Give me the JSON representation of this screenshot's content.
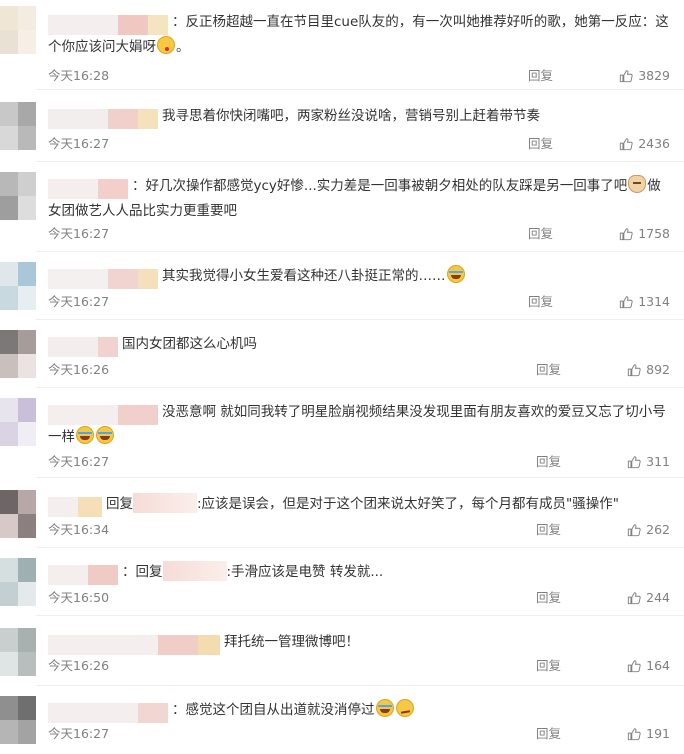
{
  "comments": [
    {
      "avatar_colors": [
        "#efe6d6",
        "#f3ece1",
        "#e9e1d3",
        "#f5efe6"
      ],
      "name_colors": [
        "#f4eeee",
        "#f0c8c1",
        "#f5e4c0"
      ],
      "prefix": "：",
      "reply_to": false,
      "text": "反正杨超越一直在节目里cue队友的，有一次叫她推荐好听的歌，她第一反应：这个你应该问大娟呀",
      "emojis": [
        "kiss"
      ],
      "suffix": "。",
      "time": "今天16:28",
      "reply_label": "回复",
      "likes": "3829"
    },
    {
      "avatar_colors": [
        "#c8c8c8",
        "#a8a8a8",
        "#d8d8d8",
        "#b9b9b9"
      ],
      "name_colors": [
        "#f3eeee",
        "#f1d0cc",
        "#f5e2bd"
      ],
      "prefix": "",
      "reply_to": false,
      "text": "我寻思着你快闭嘴吧，两家粉丝没说啥，营销号别上赶着带节奏",
      "emojis": [],
      "suffix": "",
      "time": "今天16:27",
      "reply_label": "回复",
      "likes": "2436"
    },
    {
      "avatar_colors": [
        "#b8b8b8",
        "#cfcfcf",
        "#9e9e9e",
        "#dddddd"
      ],
      "name_colors": [
        "#f6eeee",
        "#f2cfca"
      ],
      "prefix": "：",
      "reply_to": false,
      "text": "好几次操作都感觉ycy好惨...实力差是一回事被朝夕相处的队友踩是另一回事了吧",
      "emojis": [
        "cat"
      ],
      "suffix": "做女团做艺人人品比实力更重要吧",
      "time": "今天16:27",
      "reply_label": "回复",
      "likes": "1758"
    },
    {
      "avatar_colors": [
        "#dfe7ea",
        "#a9c7d8",
        "#c9d9e0",
        "#e6eef1"
      ],
      "name_colors": [
        "#f4f0f0",
        "#f1d3cf",
        "#f5e0bd"
      ],
      "prefix": "",
      "reply_to": false,
      "text": "其实我觉得小女生爱看这种还八卦挺正常的……",
      "emojis": [
        "laugh"
      ],
      "suffix": "",
      "time": "今天16:27",
      "reply_label": "回复",
      "likes": "1314"
    },
    {
      "avatar_colors": [
        "#7d7878",
        "#a69d9b",
        "#c9bfbd",
        "#eae3e1"
      ],
      "name_colors": [
        "#f3eded",
        "#f0d2ce"
      ],
      "prefix": "",
      "reply_to": false,
      "text": "国内女团都这么心机吗",
      "emojis": [],
      "suffix": "",
      "time": "今天16:26",
      "reply_label": "回复",
      "likes": "892"
    },
    {
      "avatar_colors": [
        "#e8e4ee",
        "#c9bfd8",
        "#d9d3e3",
        "#f0edf4"
      ],
      "name_colors": [
        "#f5eeee",
        "#f1cfca"
      ],
      "prefix": "",
      "reply_to": false,
      "text": "没恶意啊 就如同我转了明星脸崩视频结果没发现里面有朋友喜欢的爱豆又忘了切小号一样",
      "emojis": [
        "laugh",
        "laugh"
      ],
      "suffix": "",
      "time": "今天16:27",
      "reply_label": "回复",
      "likes": "311"
    },
    {
      "avatar_colors": [
        "#6e6666",
        "#b7a7a7",
        "#d8c9c9",
        "#8b7f7f"
      ],
      "name_colors": [
        "#f4eeee",
        "#f5dfb8"
      ],
      "prefix": "",
      "reply_to": true,
      "reply_word": "回复",
      "text": ":应该是误会，但是对于这个团来说太好笑了，每个月都有成员\"骚操作\"",
      "emojis": [],
      "suffix": "",
      "time": "今天16:34",
      "reply_label": "回复",
      "likes": "262"
    },
    {
      "avatar_colors": [
        "#d6dfe0",
        "#9fb0b3",
        "#c4cfd1",
        "#e4eaeb"
      ],
      "name_colors": [
        "#f4eeee",
        "#f0cac5"
      ],
      "prefix": "：",
      "reply_to": true,
      "reply_word": "回复",
      "text": ":手滑应该是电赞 转发就...",
      "emojis": [],
      "suffix": "",
      "time": "今天16:50",
      "reply_label": "回复",
      "likes": "244"
    },
    {
      "avatar_colors": [
        "#c9cfcf",
        "#a9b0b0",
        "#dfe4e4",
        "#b8bebe"
      ],
      "name_colors": [
        "#f5eeee",
        "#f1cdc8",
        "#f4dcae"
      ],
      "prefix": "",
      "reply_to": false,
      "text": "拜托统一管理微博吧！",
      "emojis": [],
      "suffix": "",
      "time": "今天16:26",
      "reply_label": "回复",
      "likes": "164"
    },
    {
      "avatar_colors": [
        "#8f8f8f",
        "#6f6f6f",
        "#b5b5b5",
        "#a3a3a3"
      ],
      "name_colors": [
        "#f4eeee",
        "#f1d6d1"
      ],
      "prefix": "：",
      "reply_to": false,
      "text": "感觉这个团自从出道就没消停过",
      "emojis": [
        "laugh",
        "smug"
      ],
      "suffix": "",
      "time": "今天16:27",
      "reply_label": "回复",
      "likes": "191"
    }
  ]
}
